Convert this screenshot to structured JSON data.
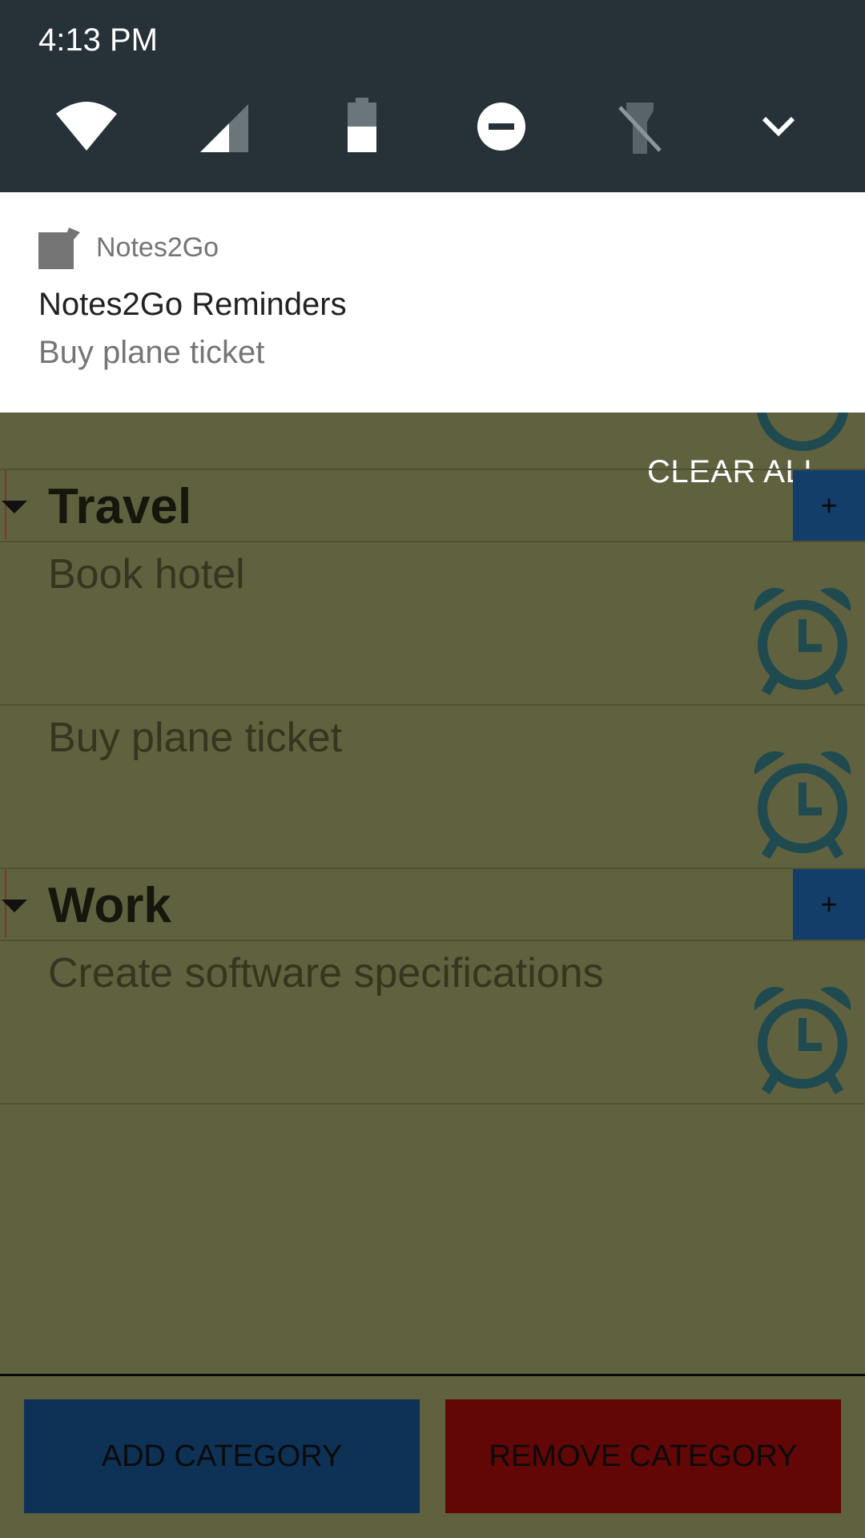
{
  "status": {
    "time": "4:13 PM"
  },
  "quick_settings": [
    "wifi-icon",
    "cellular-signal-icon",
    "battery-icon",
    "do-not-disturb-icon",
    "flashlight-off-icon",
    "expand-chevron-icon"
  ],
  "notification": {
    "app_name": "Notes2Go",
    "title": "Notes2Go Reminders",
    "text": "Buy plane ticket",
    "clear_all": "CLEAR ALL"
  },
  "categories": [
    {
      "name": "Travel",
      "add_label": "+",
      "notes": [
        "Book hotel",
        "Buy plane ticket"
      ]
    },
    {
      "name": "Work",
      "add_label": "+",
      "notes": [
        "Create software specifications"
      ]
    }
  ],
  "buttons": {
    "add_category": "ADD CATEGORY",
    "remove_category": "REMOVE CATEGORY"
  },
  "colors": {
    "shade": "#263238",
    "app_background": "#5f613f",
    "add_button": "#0e3156",
    "remove_button": "#620606",
    "alarm_icon": "#1f4a4f"
  }
}
